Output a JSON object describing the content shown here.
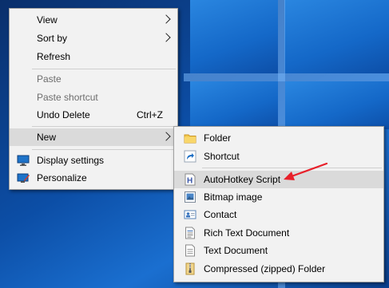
{
  "context_menu": {
    "items": [
      {
        "label": "View"
      },
      {
        "label": "Sort by"
      },
      {
        "label": "Refresh"
      },
      {
        "label": "Paste"
      },
      {
        "label": "Paste shortcut"
      },
      {
        "label": "Undo Delete",
        "shortcut": "Ctrl+Z"
      },
      {
        "label": "New"
      },
      {
        "label": "Display settings",
        "icon": "display-settings-icon"
      },
      {
        "label": "Personalize",
        "icon": "personalize-icon"
      }
    ]
  },
  "new_submenu": {
    "items": [
      {
        "label": "Folder",
        "icon": "folder-icon"
      },
      {
        "label": "Shortcut",
        "icon": "shortcut-icon"
      },
      {
        "label": "AutoHotkey Script",
        "icon": "autohotkey-script-icon"
      },
      {
        "label": "Bitmap image",
        "icon": "bitmap-image-icon"
      },
      {
        "label": "Contact",
        "icon": "contact-icon"
      },
      {
        "label": "Rich Text Document",
        "icon": "rich-text-document-icon"
      },
      {
        "label": "Text Document",
        "icon": "text-document-icon"
      },
      {
        "label": "Compressed (zipped) Folder",
        "icon": "zip-folder-icon"
      }
    ]
  },
  "colors": {
    "menu_background": "#f2f2f2",
    "highlight": "#dadada",
    "disabled_text": "#6d6d6d",
    "annotation_arrow": "#e8202a",
    "desktop_blue": "#0c4ea6"
  }
}
